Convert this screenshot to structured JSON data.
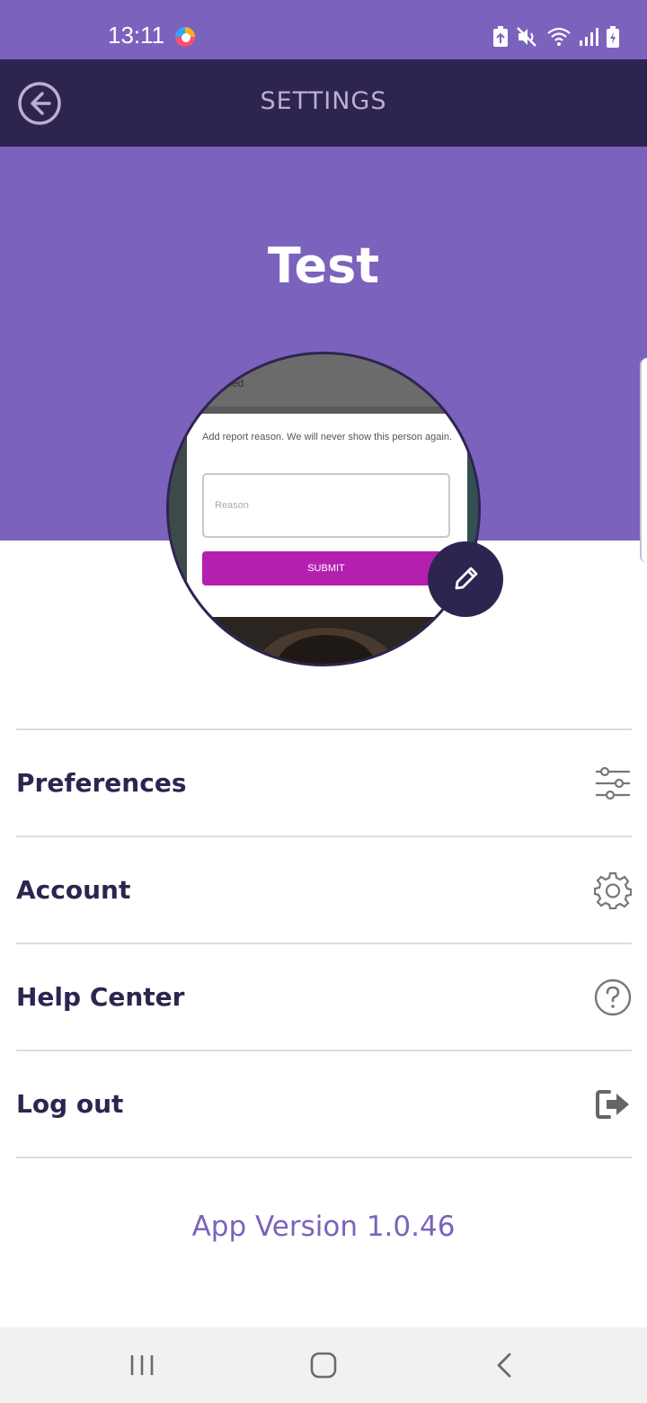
{
  "status_bar": {
    "time": "13:11",
    "icons": [
      "app-notification-icon",
      "battery-saver-icon",
      "mute-icon",
      "wifi-icon",
      "signal-icon",
      "battery-charging-icon"
    ]
  },
  "header": {
    "title": "SETTINGS",
    "back_icon": "back-arrow-icon"
  },
  "profile": {
    "name": "Test",
    "photo": {
      "top_text": "ssed",
      "card_text": "Add report reason. We will never show this person again.",
      "input_placeholder": "Reason",
      "submit_label": "SUBMIT"
    },
    "edit_icon": "pencil-icon"
  },
  "menu": {
    "items": [
      {
        "label": "Preferences",
        "icon": "sliders-icon"
      },
      {
        "label": "Account",
        "icon": "gear-icon"
      },
      {
        "label": "Help Center",
        "icon": "help-icon"
      },
      {
        "label": "Log out",
        "icon": "logout-icon"
      }
    ]
  },
  "footer": {
    "app_version": "App Version 1.0.46"
  },
  "nav_bar": {
    "icons": [
      "recent-apps-icon",
      "home-icon",
      "back-icon"
    ]
  },
  "colors": {
    "primary": "#7b63bd",
    "dark": "#2e2450",
    "submit": "#b51fb0"
  }
}
